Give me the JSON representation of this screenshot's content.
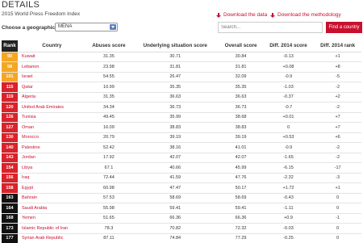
{
  "header": {
    "title": "DETAILS",
    "subtitle": "2015 World Press Freedom Index",
    "download_data": "Download the data",
    "download_methodology": "Download the methodology"
  },
  "filter": {
    "label": "Choose a geographic area:",
    "selected": "MENA"
  },
  "search": {
    "placeholder": "Search...",
    "button": "Find a country"
  },
  "table": {
    "headers": [
      "Rank",
      "Country",
      "Abuses score",
      "Underlying situation score",
      "Overall score",
      "Diff. 2014 score",
      "Diff. 2014 rank"
    ],
    "rows": [
      {
        "rank": "90",
        "country": "Kuwait",
        "abuses": "31.35",
        "underlying": "30.71",
        "overall": "30.84",
        "diff_score": "-0.13",
        "diff_rank": "+1",
        "color": "#f5a623"
      },
      {
        "rank": "98",
        "country": "Lebanon",
        "abuses": "23.98",
        "underlying": "31.81",
        "overall": "31.81",
        "diff_score": "+0.08",
        "diff_rank": "+8",
        "color": "#f5a623"
      },
      {
        "rank": "101",
        "country": "Israel",
        "abuses": "54.55",
        "underlying": "26.47",
        "overall": "32.09",
        "diff_score": "-0.9",
        "diff_rank": "-5",
        "color": "#f5a623"
      },
      {
        "rank": "115",
        "country": "Qatar",
        "abuses": "10.99",
        "underlying": "35.35",
        "overall": "35.35",
        "diff_score": "-1.03",
        "diff_rank": "-2",
        "color": "#d9222a"
      },
      {
        "rank": "119",
        "country": "Algeria",
        "abuses": "31.35",
        "underlying": "36.63",
        "overall": "36.63",
        "diff_score": "-0.37",
        "diff_rank": "+2",
        "color": "#d9222a"
      },
      {
        "rank": "120",
        "country": "United Arab Emirates",
        "abuses": "34.34",
        "underlying": "36.73",
        "overall": "36.73",
        "diff_score": "-0.7",
        "diff_rank": "-2",
        "color": "#d9222a"
      },
      {
        "rank": "126",
        "country": "Tunisia",
        "abuses": "49.45",
        "underlying": "35.99",
        "overall": "38.68",
        "diff_score": "+0.01",
        "diff_rank": "+7",
        "color": "#d9222a"
      },
      {
        "rank": "127",
        "country": "Oman",
        "abuses": "16.09",
        "underlying": "38.83",
        "overall": "38.83",
        "diff_score": "0",
        "diff_rank": "+7",
        "color": "#d9222a"
      },
      {
        "rank": "130",
        "country": "Morocco",
        "abuses": "20.79",
        "underlying": "39.19",
        "overall": "39.19",
        "diff_score": "+0.53",
        "diff_rank": "+6",
        "color": "#d9222a"
      },
      {
        "rank": "140",
        "country": "Palestine",
        "abuses": "52.42",
        "underlying": "38.16",
        "overall": "41.01",
        "diff_score": "-0.9",
        "diff_rank": "-2",
        "color": "#d9222a"
      },
      {
        "rank": "143",
        "country": "Jordan",
        "abuses": "17.92",
        "underlying": "42.07",
        "overall": "42.07",
        "diff_score": "-1.65",
        "diff_rank": "-2",
        "color": "#d9222a"
      },
      {
        "rank": "154",
        "country": "Libya",
        "abuses": "67.1",
        "underlying": "40.66",
        "overall": "45.99",
        "diff_score": "-6.15",
        "diff_rank": "-17",
        "color": "#d9222a"
      },
      {
        "rank": "156",
        "country": "Iraq",
        "abuses": "72.44",
        "underlying": "41.59",
        "overall": "47.76",
        "diff_score": "-2.32",
        "diff_rank": "-3",
        "color": "#d9222a"
      },
      {
        "rank": "158",
        "country": "Egypt",
        "abuses": "60.98",
        "underlying": "47.47",
        "overall": "50.17",
        "diff_score": "+1.72",
        "diff_rank": "+1",
        "color": "#d9222a"
      },
      {
        "rank": "163",
        "country": "Bahrain",
        "abuses": "57.53",
        "underlying": "58.69",
        "overall": "58.69",
        "diff_score": "-0.43",
        "diff_rank": "0",
        "color": "#111111"
      },
      {
        "rank": "164",
        "country": "Saudi Arabia",
        "abuses": "55.98",
        "underlying": "59.41",
        "overall": "59.41",
        "diff_score": "-1.11",
        "diff_rank": "0",
        "color": "#111111"
      },
      {
        "rank": "168",
        "country": "Yemen",
        "abuses": "51.65",
        "underlying": "66.36",
        "overall": "66.36",
        "diff_score": "+0.9",
        "diff_rank": "-1",
        "color": "#111111"
      },
      {
        "rank": "173",
        "country": "Islamic Republic of Iran",
        "abuses": "78.3",
        "underlying": "70.82",
        "overall": "72.32",
        "diff_score": "-0.03",
        "diff_rank": "0",
        "color": "#111111"
      },
      {
        "rank": "177",
        "country": "Syrian Arab Republic",
        "abuses": "87.11",
        "underlying": "74.84",
        "overall": "77.29",
        "diff_score": "-0.25",
        "diff_rank": "0",
        "color": "#111111"
      }
    ]
  }
}
